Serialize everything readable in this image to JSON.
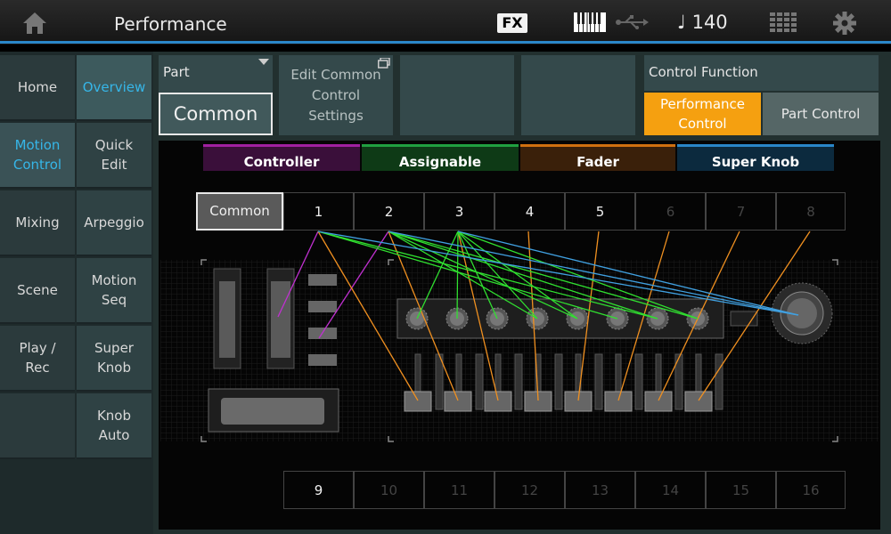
{
  "header": {
    "title": "Performance",
    "fx_label": "FX",
    "tempo": "♩ 140"
  },
  "nav_main": [
    {
      "label": "Home",
      "active": false
    },
    {
      "label": "Motion Control",
      "active": true
    },
    {
      "label": "Mixing",
      "active": false
    },
    {
      "label": "Scene",
      "active": false
    },
    {
      "label": "Play / Rec",
      "active": false
    }
  ],
  "nav_sub": [
    {
      "label": "Overview",
      "active": true
    },
    {
      "label": "Quick Edit",
      "active": false
    },
    {
      "label": "Arpeggio",
      "active": false
    },
    {
      "label": "Motion Seq",
      "active": false
    },
    {
      "label": "Super Knob",
      "active": false
    },
    {
      "label": "Knob Auto",
      "active": false
    }
  ],
  "part": {
    "label": "Part",
    "value": "Common"
  },
  "edit_common": {
    "label": "Edit Common Control Settings"
  },
  "control_function": {
    "label": "Control Function",
    "performance_control": "Performance Control",
    "part_control": "Part Control"
  },
  "categories": [
    {
      "label": "Controller",
      "color": "#a020a0",
      "bg": "#3a0f3a"
    },
    {
      "label": "Assignable",
      "color": "#20a040",
      "bg": "#0e3a16"
    },
    {
      "label": "Fader",
      "color": "#d07010",
      "bg": "#3a200a"
    },
    {
      "label": "Super Knob",
      "color": "#2a86c8",
      "bg": "#0c2a3e"
    }
  ],
  "top_row": {
    "common": "Common",
    "parts": [
      "1",
      "2",
      "3",
      "4",
      "5",
      "6",
      "7",
      "8"
    ],
    "active_parts": 5
  },
  "bottom_row": {
    "parts": [
      "9",
      "10",
      "11",
      "12",
      "13",
      "14",
      "15",
      "16"
    ],
    "active_parts": 1
  },
  "colors": {
    "controller": "#b030d0",
    "assignable": "#30e030",
    "fader": "#f09020",
    "super_knob": "#40a0e0",
    "accent": "#36b6e8",
    "highlight": "#f5a010"
  }
}
